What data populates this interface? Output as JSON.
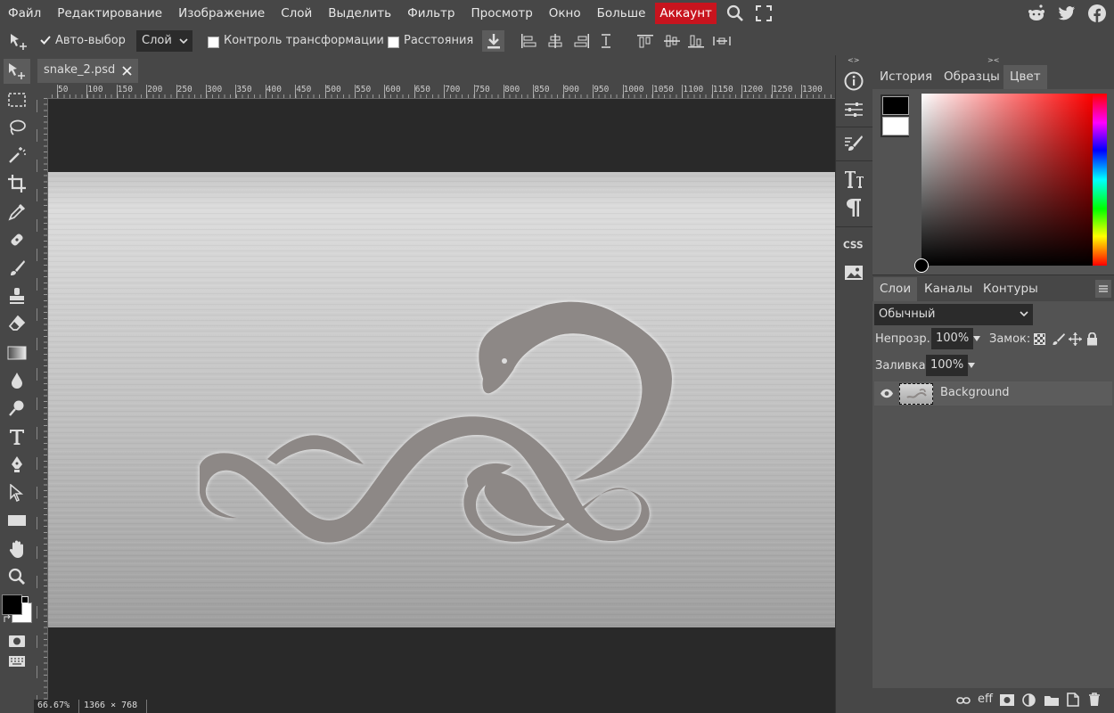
{
  "menu": {
    "items": [
      "Файл",
      "Редактирование",
      "Изображение",
      "Слой",
      "Выделить",
      "Фильтр",
      "Просмотр",
      "Окно",
      "Больше"
    ],
    "account": "Аккаунт"
  },
  "options": {
    "auto_select": "Авто-выбор",
    "layer_select": "Слой",
    "transform_controls": "Контроль трансформации",
    "distances": "Расстояния"
  },
  "document": {
    "tab_name": "snake_2.psd",
    "zoom": "66.67%",
    "size": "1366 × 768"
  },
  "ruler": {
    "h_ticks": [
      "50",
      "100",
      "150",
      "200",
      "250",
      "300",
      "350",
      "400",
      "450",
      "500",
      "550",
      "600",
      "650",
      "700",
      "750",
      "800",
      "850",
      "900",
      "950",
      "1000",
      "1050",
      "1100",
      "1150",
      "1200",
      "1250",
      "1300"
    ]
  },
  "panels": {
    "top_tabs": [
      "История",
      "Образцы",
      "Цвет"
    ],
    "layer_tabs": [
      "Слои",
      "Каналы",
      "Контуры"
    ],
    "blend_mode": "Обычный",
    "opacity_label": "Непрозр.:",
    "opacity_value": "100%",
    "lock_label": "Замок:",
    "fill_label": "Заливка:",
    "fill_value": "100%",
    "layer_name": "Background",
    "collapse_left": "<>",
    "collapse_right": "><",
    "eff": "eff"
  },
  "colors": {
    "foreground": "#000000",
    "background": "#ffffff",
    "accent": "#c8141e"
  }
}
